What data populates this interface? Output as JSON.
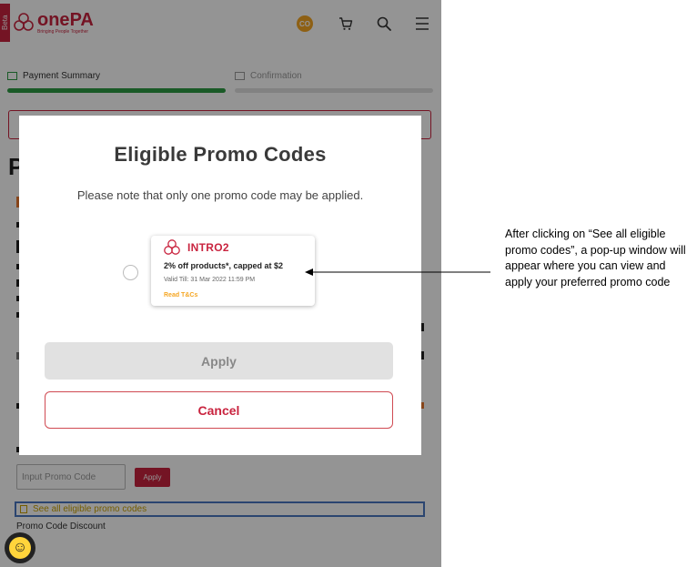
{
  "header": {
    "beta_label": "Beta",
    "brand_name_one": "one",
    "brand_name_pa": "PA",
    "brand_tagline": "Bringing People Together",
    "avatar_initials": "CO",
    "icons": [
      "cart-icon",
      "search-icon",
      "menu-icon"
    ]
  },
  "steps": [
    {
      "label": "Payment Summary",
      "state": "active"
    },
    {
      "label": "Confirmation",
      "state": "inactive"
    }
  ],
  "background": {
    "promo_input_placeholder": "Input Promo Code",
    "promo_apply_label": "Apply",
    "see_all_link": "See all eligible promo codes",
    "promo_discount_label": "Promo Code Discount"
  },
  "modal": {
    "title": "Eligible Promo Codes",
    "note": "Please note that only one promo code may be applied.",
    "promo": {
      "code": "INTRO2",
      "description": "2% off products*, capped at $2",
      "valid_till": "Valid Till: 31 Mar 2022 11:59 PM",
      "terms_link": "Read T&Cs",
      "selected": false
    },
    "apply_label": "Apply",
    "cancel_label": "Cancel"
  },
  "annotation": {
    "text": "After clicking on “See all eligible promo codes”, a pop-up window will appear where you can view and apply your preferred promo code"
  },
  "colors": {
    "brand_red": "#c9243f",
    "progress_green": "#2e9b44",
    "accent_orange": "#f5a623",
    "highlight_blue": "#4a78c2"
  }
}
